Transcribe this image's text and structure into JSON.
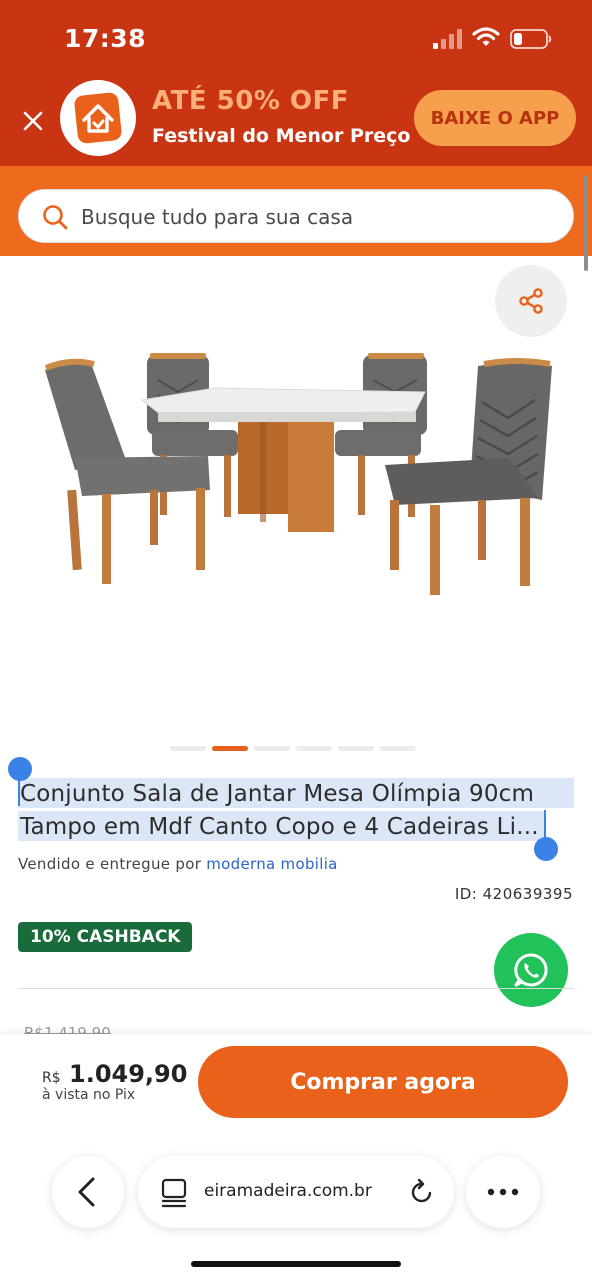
{
  "status_bar": {
    "time": "17:38"
  },
  "promo": {
    "title": "ATÉ 50% OFF",
    "subtitle": "Festival do Menor Preço",
    "button": "BAIXE O APP"
  },
  "search": {
    "placeholder": "Busque tudo para sua casa"
  },
  "product": {
    "title_line1": "Conjunto Sala de Jantar Mesa Olímpia 90cm",
    "title_line2": "Tampo em Mdf Canto Copo e 4 Cadeiras Li...",
    "seller_prefix": "Vendido e entregue por",
    "seller_name": "moderna mobilia",
    "id_text": "ID: 420639395",
    "cashback": "10% CASHBACK",
    "old_price": "R$1.419,90",
    "image_count": 6,
    "active_image": 2
  },
  "purchase": {
    "currency": "R$",
    "price": "1.049,90",
    "price_note": "à vista no Pix",
    "buy_button": "Comprar agora"
  },
  "browser": {
    "url": "eiramadeira.com.br"
  },
  "colors": {
    "header_red": "#c93412",
    "search_orange": "#ee6b1d",
    "buy_orange": "#e9611a",
    "cashback_green": "#1a6b3c",
    "whatsapp_green": "#22c25a",
    "seller_link": "#2b63c8"
  }
}
